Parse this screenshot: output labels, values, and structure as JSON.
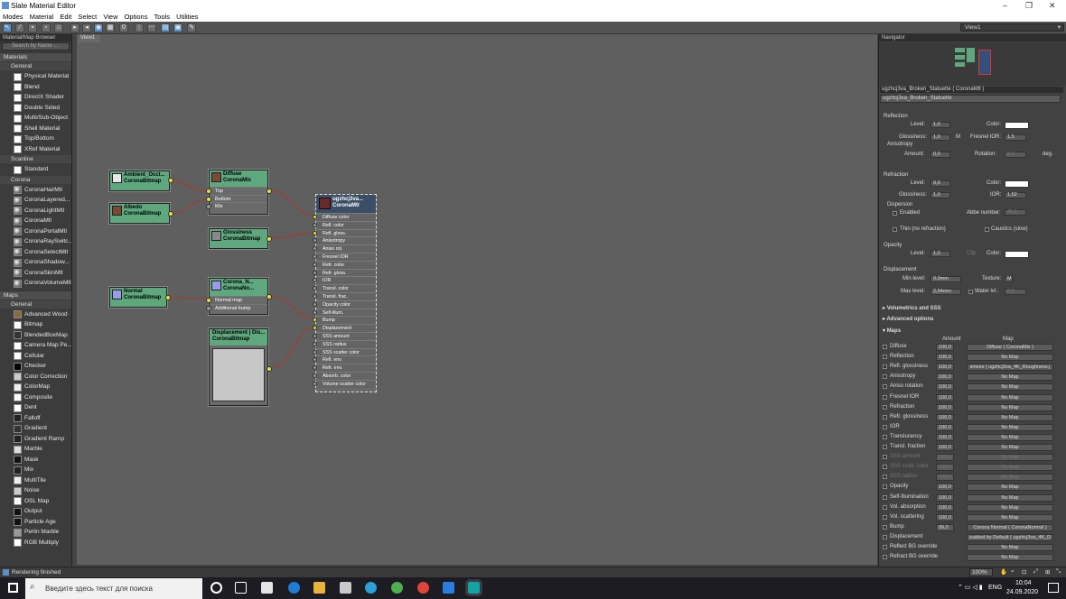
{
  "window": {
    "title": "Slate Material Editor",
    "minimize": "–",
    "maximize": "❐",
    "close": "✕"
  },
  "menu": [
    "Modes",
    "Material",
    "Edit",
    "Select",
    "View",
    "Options",
    "Tools",
    "Utilities"
  ],
  "toolbar": {
    "view_selector": "View1"
  },
  "browser": {
    "title": "Material/Map Browser",
    "search_placeholder": "Search by Name ...",
    "materials_label": "Materials",
    "general_label": "General",
    "general_items": [
      "Physical Material",
      "Blend",
      "DirectX Shader",
      "Double Sided",
      "Multi/Sub-Object",
      "Shell Material",
      "Top/Bottom",
      "XRef Material"
    ],
    "scanline_label": "Scanline",
    "scanline_items": [
      "Standard"
    ],
    "corona_label": "Corona",
    "corona_items": [
      "CoronaHairMtl",
      "CoronaLayered...",
      "CoronaLightMtl",
      "CoronaMtl",
      "CoronaPortalMtl",
      "CoronaRaySwitc...",
      "CoronaSelectMtl",
      "CoronaShadow...",
      "CoronaSkinMtl",
      "CoronaVolumeMtl"
    ],
    "maps_label": "Maps",
    "maps_general_label": "General",
    "maps_items": [
      "Advanced Wood",
      "Bitmap",
      "BlendedBoxMap",
      "Camera Map Pe...",
      "Cellular",
      "Checker",
      "Color Correction",
      "ColorMap",
      "Composite",
      "Dent",
      "Falloff",
      "Gradient",
      "Gradient Ramp",
      "Marble",
      "Mask",
      "Mix",
      "MultiTile",
      "Noise",
      "OSL Map",
      "Output",
      "Particle Age",
      "Perlin Marble",
      "RGB Multiply"
    ]
  },
  "view": {
    "tab": "View1"
  },
  "nodes": {
    "ao": {
      "title": "Ambient_Occl...",
      "type": "CoronaBitmap"
    },
    "albedo": {
      "title": "Albedo",
      "type": "CoronaBitmap"
    },
    "diffuse": {
      "title": "Diffuse",
      "type": "CoronaMix",
      "slots": [
        "Top",
        "Bottom",
        "Mix"
      ]
    },
    "gloss": {
      "title": "Glossiness",
      "type": "CoronaBitmap"
    },
    "normal": {
      "title": "Normal",
      "type": "CoronaBitmap"
    },
    "cnormal": {
      "title": "Corona_N...",
      "type": "CoronaNo...",
      "slots": [
        "Normal map",
        "Additional bump"
      ]
    },
    "disp": {
      "title": "Displacement | Dis...",
      "type": "CoronaBitmap"
    },
    "main": {
      "title": "ugzhcj3va...",
      "type": "CoronaMtl",
      "slots": [
        "Diffuse color",
        "Refl. color",
        "Refl. gloss.",
        "Anisotropy",
        "Aniso rot.",
        "Fresnel IOR",
        "Refr. color",
        "Refr. gloss.",
        "IOR",
        "Transl. color",
        "Transl. frac.",
        "Opacity color",
        "Self-illum.",
        "Bump",
        "Displacement",
        "SSS amount",
        "SSS radius",
        "SSS scatter color",
        "Refl. env.",
        "Refr. env.",
        "Absorb. color",
        "Volume scatter color"
      ]
    }
  },
  "navigator": {
    "title": "Navigator"
  },
  "params": {
    "name": "ugzhcj3va_Broken_Statuette ( CoronaMtl )",
    "name_field": "ugzhcj3va_Broken_Statuette",
    "reflection": {
      "label": "Reflection",
      "level_label": "Level:",
      "level": "1,0",
      "color_label": "Color:",
      "gloss_label": "Glossiness:",
      "gloss": "1,0",
      "m": "M",
      "fresnel_label": "Fresnel IOR:",
      "fresnel": "1,5",
      "aniso_label": "Anisotropy",
      "amount_label": "Amount:",
      "amount": "0,0",
      "rotation_label": "Rotation:",
      "rotation": "0,0",
      "deg": "deg."
    },
    "refraction": {
      "label": "Refraction",
      "level_label": "Level:",
      "level": "0,0",
      "color_label": "Color:",
      "gloss_label": "Glossiness:",
      "gloss": "1,0",
      "ior_label": "IOR:",
      "ior": "1,52",
      "dispersion_label": "Dispersion",
      "enabled_label": "Enabled",
      "abbe_label": "Abbe number:",
      "abbe": "40,0",
      "thin_label": "Thin (no refraction)",
      "caustics_label": "Caustics (slow)"
    },
    "opacity": {
      "label": "Opacity",
      "level_label": "Level:",
      "level": "1,0",
      "clip_label": "Clip",
      "color_label": "Color:"
    },
    "displacement": {
      "label": "Displacement",
      "min_label": "Min level:",
      "min": "0,0mm",
      "texture_label": "Texture:",
      "texture": "M",
      "max_label": "Max level:",
      "max": "2,54mm",
      "water_label": "Water lvl.:",
      "water": "0,5"
    },
    "rollouts": [
      "Volumetrics and SSS",
      "Advanced options",
      "Maps"
    ],
    "maps_header": {
      "amount": "Amount",
      "map": "Map"
    },
    "maps": [
      {
        "label": "Diffuse",
        "amount": "100,0",
        "map": "Diffuse ( CoronaMix )",
        "dim": false
      },
      {
        "label": "Reflection",
        "amount": "100,0",
        "map": "No Map",
        "dim": false
      },
      {
        "label": "Refl. glossiness",
        "amount": "100,0",
        "map": "siness ( ugzhcj3va_4K_Roughness.j",
        "dim": false
      },
      {
        "label": "Anisotropy",
        "amount": "100,0",
        "map": "No Map",
        "dim": false
      },
      {
        "label": "Aniso rotation",
        "amount": "100,0",
        "map": "No Map",
        "dim": false
      },
      {
        "label": "Fresnel IOR",
        "amount": "100,0",
        "map": "No Map",
        "dim": false
      },
      {
        "label": "Refraction",
        "amount": "100,0",
        "map": "No Map",
        "dim": false
      },
      {
        "label": "Refr. glossiness",
        "amount": "100,0",
        "map": "No Map",
        "dim": false
      },
      {
        "label": "IOR",
        "amount": "100,0",
        "map": "No Map",
        "dim": false
      },
      {
        "label": "Translucency",
        "amount": "100,0",
        "map": "No Map",
        "dim": false
      },
      {
        "label": "Transl. fraction",
        "amount": "100,0",
        "map": "No Map",
        "dim": false
      },
      {
        "label": "SSS amount",
        "amount": "100,0",
        "map": "No Map",
        "dim": true
      },
      {
        "label": "SSS scatt. color",
        "amount": "100,0",
        "map": "No Map",
        "dim": true
      },
      {
        "label": "SSS radius",
        "amount": "100,0",
        "map": "No Map",
        "dim": true
      },
      {
        "label": "Opacity",
        "amount": "100,0",
        "map": "No Map",
        "dim": false
      },
      {
        "label": "Self-Illumination",
        "amount": "100,0",
        "map": "No Map",
        "dim": false
      },
      {
        "label": "Vol. absorption",
        "amount": "100,0",
        "map": "No Map",
        "dim": false
      },
      {
        "label": "Vol. scattering",
        "amount": "100,0",
        "map": "No Map",
        "dim": false
      },
      {
        "label": "Bump",
        "amount": "99,0",
        "map": "Corona Normal ( CoronaNormal )",
        "dim": false
      },
      {
        "label": "Displacement",
        "amount": "",
        "map": "isabled by Default ( ugzhcj3va_4K_D",
        "dim": false
      },
      {
        "label": "Reflect BG override",
        "amount": "",
        "map": "No Map",
        "dim": false
      },
      {
        "label": "Refract BG override",
        "amount": "",
        "map": "No Map",
        "dim": false
      }
    ]
  },
  "status": {
    "text": "Rendering finished",
    "zoom": "100%"
  },
  "taskbar": {
    "search_placeholder": "Введите здесь текст для поиска",
    "lang": "ENG",
    "time": "10:04",
    "date": "24.09.2020"
  }
}
